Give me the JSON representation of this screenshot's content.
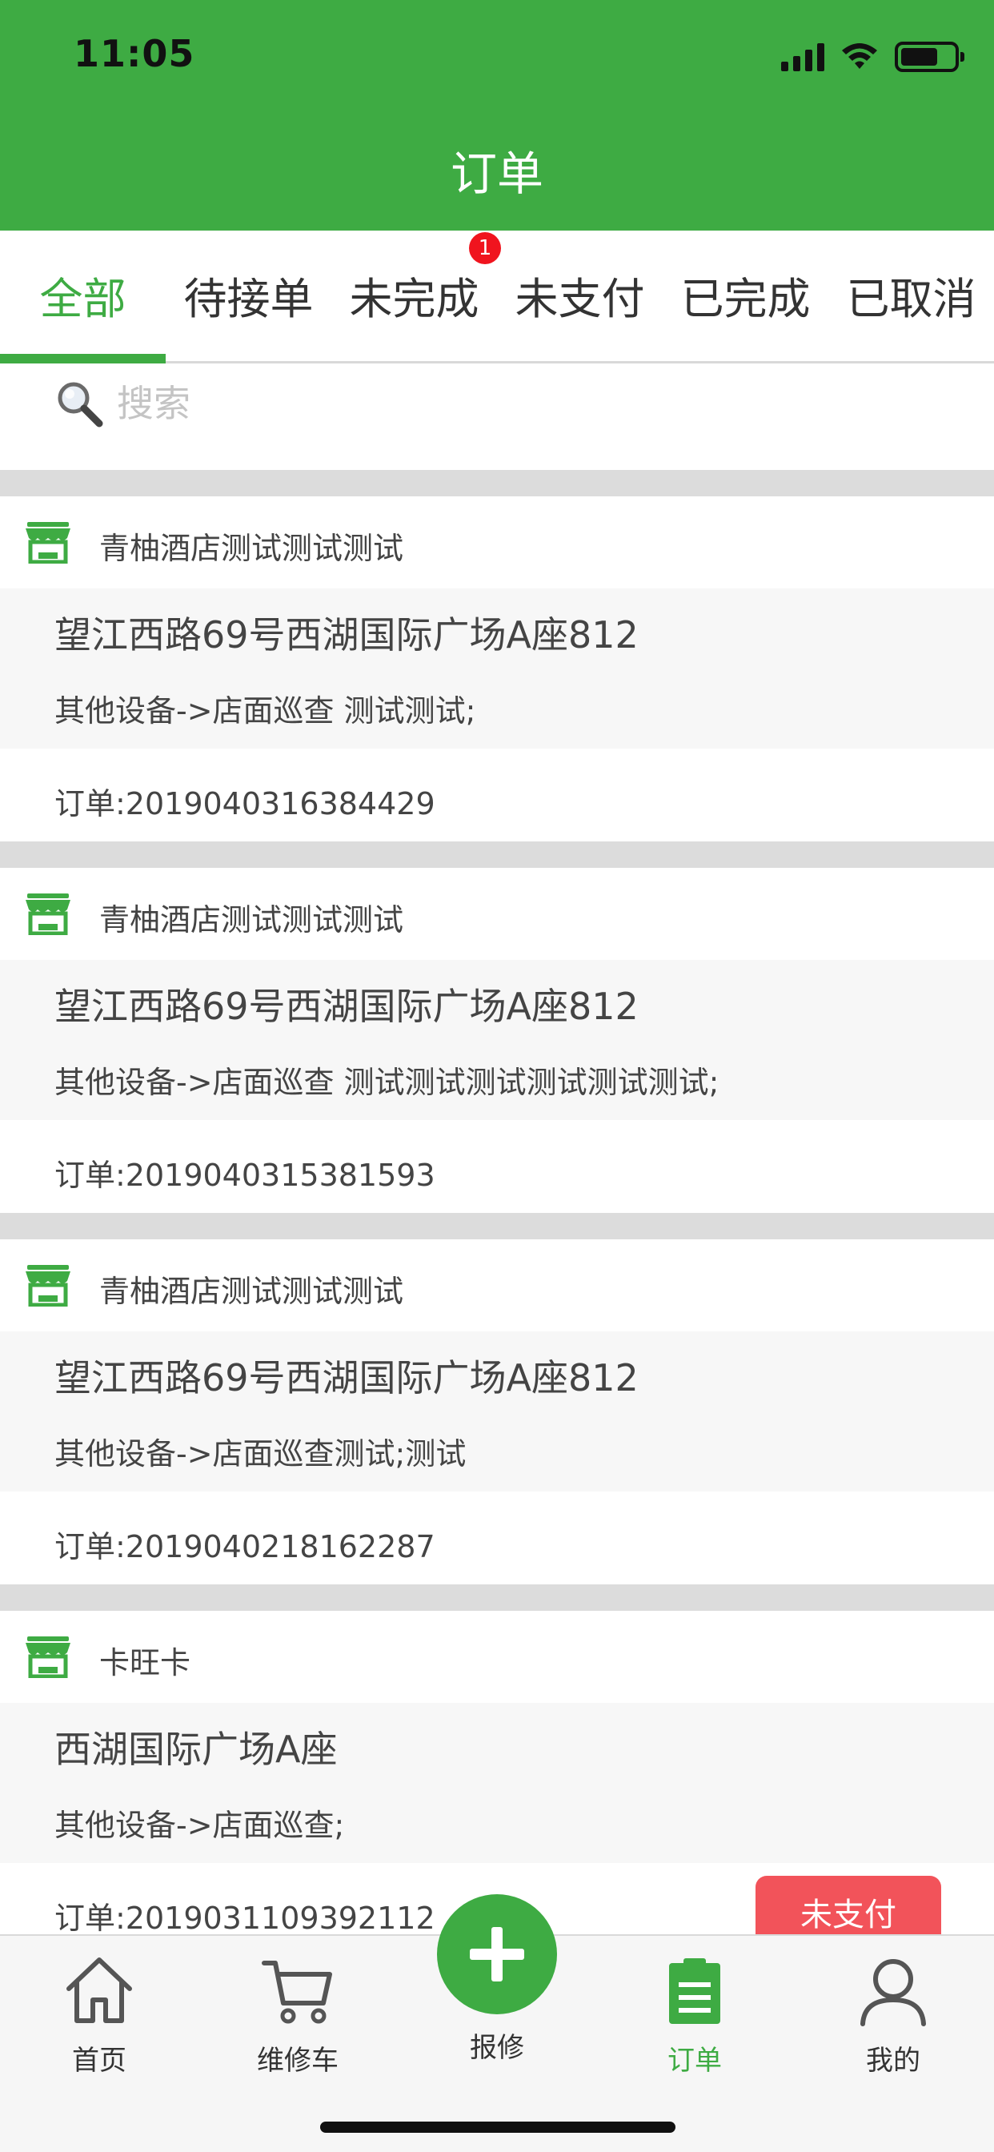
{
  "status_bar": {
    "time": "11:05"
  },
  "header": {
    "title": "订单"
  },
  "tabs": [
    {
      "label": "全部",
      "active": true
    },
    {
      "label": "待接单"
    },
    {
      "label": "未完成",
      "badge": "1"
    },
    {
      "label": "未支付"
    },
    {
      "label": "已完成"
    },
    {
      "label": "已取消"
    }
  ],
  "search": {
    "placeholder": "搜索",
    "value": ""
  },
  "orders": [
    {
      "shop": "青柚酒店测试测试测试",
      "address": "望江西路69号西湖国际广场A座812",
      "description": "其他设备->店面巡查  测试测试;",
      "order_no": "订单:2019040316384429"
    },
    {
      "shop": "青柚酒店测试测试测试",
      "address": "望江西路69号西湖国际广场A座812",
      "description": "其他设备->店面巡查 测试测试测试测试测试测试;",
      "order_no": "订单:2019040315381593"
    },
    {
      "shop": "青柚酒店测试测试测试",
      "address": "望江西路69号西湖国际广场A座812",
      "description": "其他设备->店面巡查测试;测试",
      "order_no": "订单:2019040218162287"
    },
    {
      "shop": "卡旺卡",
      "address": "西湖国际广场A座",
      "description": "其他设备->店面巡查;",
      "order_no": "订单:2019031109392112",
      "status_button": "未支付"
    }
  ],
  "bottom_nav": [
    {
      "label": "首页",
      "icon": "home-icon"
    },
    {
      "label": "维修车",
      "icon": "cart-icon"
    },
    {
      "label": "报修",
      "icon": "plus-icon"
    },
    {
      "label": "订单",
      "icon": "order-list-icon",
      "active": true
    },
    {
      "label": "我的",
      "icon": "user-icon"
    }
  ],
  "colors": {
    "brand": "#3eab43",
    "badge": "#f0141e",
    "unpaid_button": "#f2535a",
    "divider": "#dcdcdc"
  }
}
